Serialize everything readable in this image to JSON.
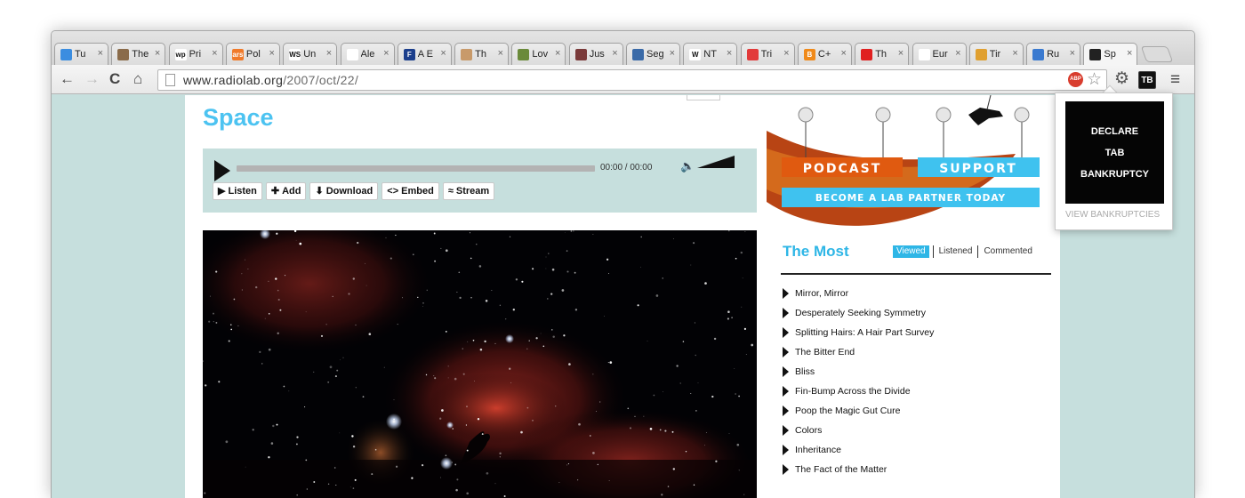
{
  "browser": {
    "tabs": [
      {
        "title": "Tu",
        "favicon_color": "#3b8de0",
        "favicon_text": ""
      },
      {
        "title": "The",
        "favicon_color": "#8a6b4a",
        "favicon_text": ""
      },
      {
        "title": "Pri",
        "favicon_color": "#ffffff",
        "favicon_text": "wp"
      },
      {
        "title": "Pol",
        "favicon_color": "#f07a2a",
        "favicon_text": "ars"
      },
      {
        "title": "Un",
        "favicon_color": "#ffffff",
        "favicon_text": "WSJ"
      },
      {
        "title": "Ale",
        "favicon_color": "#ffffff",
        "favicon_text": ""
      },
      {
        "title": "A E",
        "favicon_color": "#1b3e8c",
        "favicon_text": "F"
      },
      {
        "title": "Th",
        "favicon_color": "#c89a6a",
        "favicon_text": ""
      },
      {
        "title": "Lov",
        "favicon_color": "#6a8a3a",
        "favicon_text": ""
      },
      {
        "title": "Jus",
        "favicon_color": "#7a3a3a",
        "favicon_text": ""
      },
      {
        "title": "Seg",
        "favicon_color": "#3a6aa8",
        "favicon_text": ""
      },
      {
        "title": "NT",
        "favicon_color": "#ffffff",
        "favicon_text": "W"
      },
      {
        "title": "Tri",
        "favicon_color": "#e23a3a",
        "favicon_text": ""
      },
      {
        "title": "C+",
        "favicon_color": "#f08a1a",
        "favicon_text": "B"
      },
      {
        "title": "Th",
        "favicon_color": "#e02020",
        "favicon_text": ""
      },
      {
        "title": "Eur",
        "favicon_color": "#ffffff",
        "favicon_text": ""
      },
      {
        "title": "Tir",
        "favicon_color": "#e0a030",
        "favicon_text": ""
      },
      {
        "title": "Ru",
        "favicon_color": "#3a7ad0",
        "favicon_text": ""
      },
      {
        "title": "Sp",
        "favicon_color": "#222222",
        "favicon_text": ""
      }
    ],
    "url_host": "www.radiolab.org",
    "url_path": "/2007/oct/22/",
    "extension_tb": "TB",
    "abp_label": "ABP"
  },
  "page": {
    "title": "Space",
    "player": {
      "time": "00:00 / 00:00",
      "actions": [
        {
          "icon": "▶",
          "label": "Listen"
        },
        {
          "icon": "✚",
          "label": "Add"
        },
        {
          "icon": "⬇",
          "label": "Download"
        },
        {
          "icon": "<>",
          "label": "Embed"
        },
        {
          "icon": "≈",
          "label": "Stream"
        }
      ]
    }
  },
  "sidebar": {
    "podcast_label": "PODCAST",
    "support_label": "SUPPORT",
    "lab_partner_label": "BECOME A LAB PARTNER TODAY",
    "most_title": "The Most",
    "most_tabs": [
      "Viewed",
      "Listened",
      "Commented"
    ],
    "most_items": [
      "Mirror, Mirror",
      "Desperately Seeking Symmetry",
      "Splitting Hairs: A Hair Part Survey",
      "The Bitter End",
      "Bliss",
      "Fin-Bump Across the Divide",
      "Poop the Magic Gut Cure",
      "Colors",
      "Inheritance",
      "The Fact of the Matter"
    ]
  },
  "popup": {
    "line1": "DECLARE",
    "line2": "TAB",
    "line3": "BANKRUPTCY",
    "link": "VIEW BANKRUPTCIES"
  }
}
